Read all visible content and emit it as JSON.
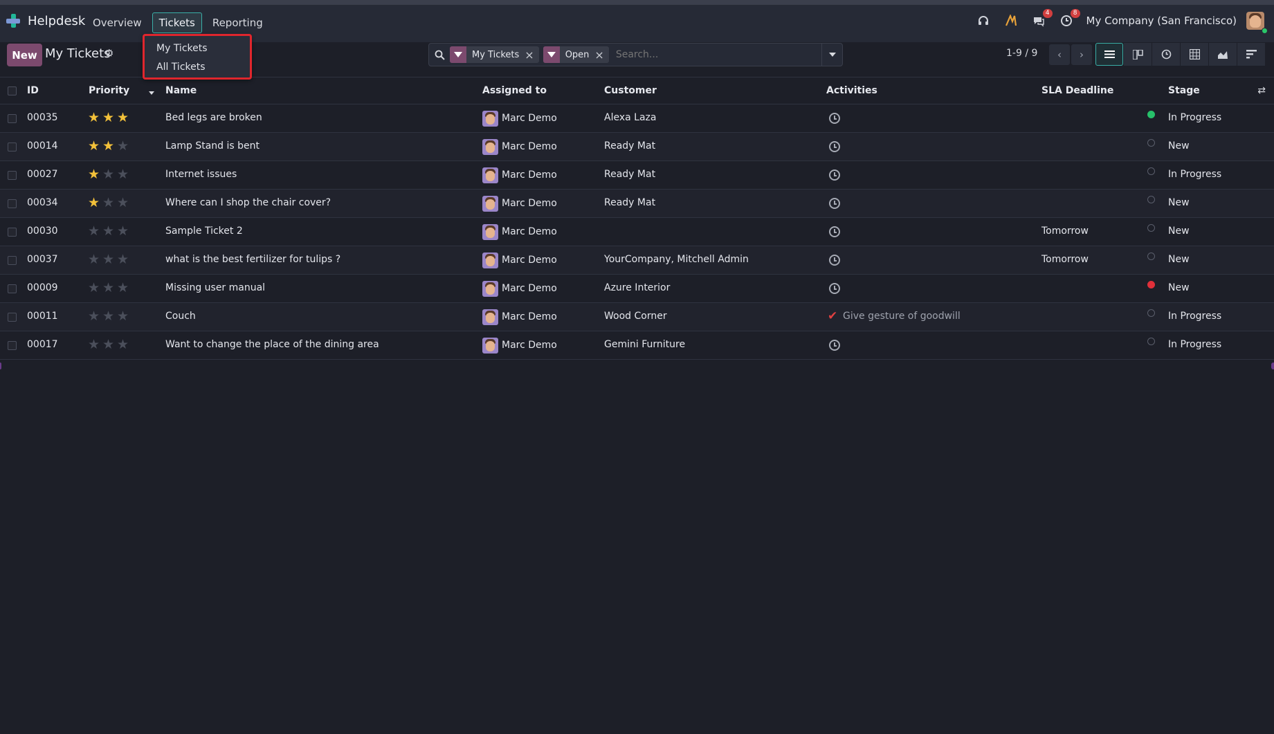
{
  "app": {
    "name": "Helpdesk"
  },
  "menu": {
    "items": [
      "Overview",
      "Tickets",
      "Reporting"
    ]
  },
  "systray": {
    "messages_badge": "4",
    "activities_badge": "8",
    "company": "My Company (San Francisco)"
  },
  "control": {
    "new_label": "New",
    "title": "My Tickets",
    "facets": [
      {
        "label": "My Tickets"
      },
      {
        "label": "Open"
      }
    ],
    "search_placeholder": "Search...",
    "pager": "1-9 / 9"
  },
  "dropdown": {
    "items": [
      "My Tickets",
      "All Tickets"
    ]
  },
  "table": {
    "headers": {
      "id": "ID",
      "priority": "Priority",
      "name": "Name",
      "assigned": "Assigned to",
      "customer": "Customer",
      "activities": "Activities",
      "sla": "SLA Deadline",
      "stage": "Stage"
    },
    "rows": [
      {
        "id": "00035",
        "priority": 3,
        "name": "Bed legs are broken",
        "assigned": "Marc Demo",
        "customer": "Alexa Laza",
        "activity": "",
        "sla": "",
        "state": "green",
        "stage": "In Progress"
      },
      {
        "id": "00014",
        "priority": 2,
        "name": "Lamp Stand is bent",
        "assigned": "Marc Demo",
        "customer": "Ready Mat",
        "activity": "",
        "sla": "",
        "state": "none",
        "stage": "New"
      },
      {
        "id": "00027",
        "priority": 1,
        "name": "Internet issues",
        "assigned": "Marc Demo",
        "customer": "Ready Mat",
        "activity": "",
        "sla": "",
        "state": "none",
        "stage": "In Progress"
      },
      {
        "id": "00034",
        "priority": 1,
        "name": "Where can I shop the chair cover?",
        "assigned": "Marc Demo",
        "customer": "Ready Mat",
        "activity": "",
        "sla": "",
        "state": "none",
        "stage": "New"
      },
      {
        "id": "00030",
        "priority": 0,
        "name": "Sample Ticket 2",
        "assigned": "Marc Demo",
        "customer": "",
        "activity": "",
        "sla": "Tomorrow",
        "state": "none",
        "stage": "New"
      },
      {
        "id": "00037",
        "priority": 0,
        "name": "what is the best fertilizer for tulips ?",
        "assigned": "Marc Demo",
        "customer": "YourCompany, Mitchell Admin",
        "activity": "",
        "sla": "Tomorrow",
        "state": "none",
        "stage": "New"
      },
      {
        "id": "00009",
        "priority": 0,
        "name": "Missing user manual",
        "assigned": "Marc Demo",
        "customer": "Azure Interior",
        "activity": "",
        "sla": "",
        "state": "red",
        "stage": "New"
      },
      {
        "id": "00011",
        "priority": 0,
        "name": "Couch",
        "assigned": "Marc Demo",
        "customer": "Wood Corner",
        "activity": "Give gesture of goodwill",
        "sla": "",
        "state": "none",
        "stage": "In Progress"
      },
      {
        "id": "00017",
        "priority": 0,
        "name": "Want to change the place of the dining area",
        "assigned": "Marc Demo",
        "customer": "Gemini Furniture",
        "activity": "",
        "sla": "",
        "state": "none",
        "stage": "In Progress"
      }
    ]
  },
  "colors": {
    "accent": "#7c4a6e",
    "teal": "#3ab0a8",
    "star": "#f3c13a",
    "highlight": "#e0262d"
  }
}
